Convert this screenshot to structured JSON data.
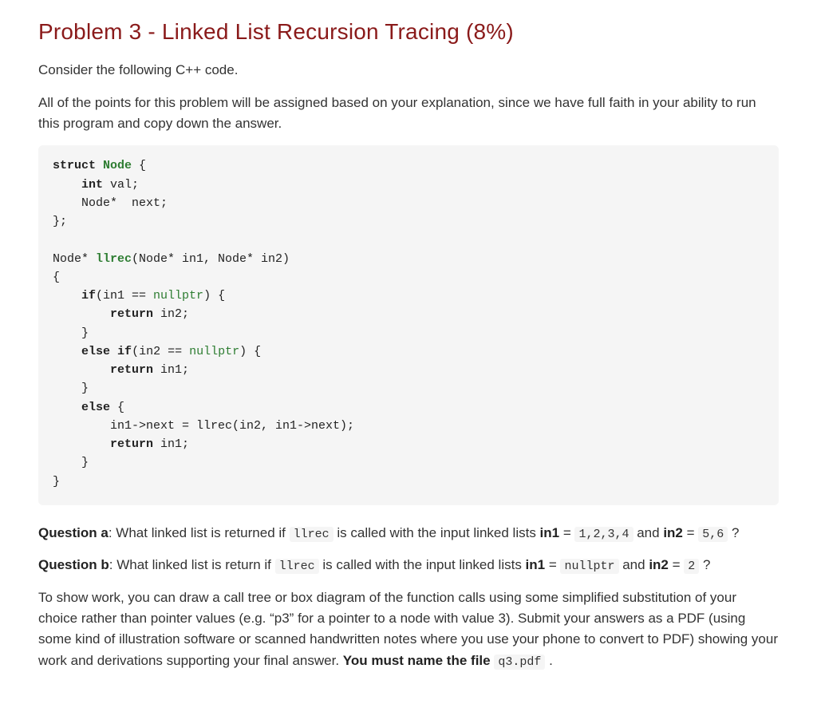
{
  "title": "Problem 3 - Linked List Recursion Tracing (8%)",
  "intro1": "Consider the following C++ code.",
  "intro2": "All of the points for this problem will be assigned based on your explanation, since we have full faith in your ability to run this program and copy down the answer.",
  "code": {
    "l01a": "struct",
    "l01b": "Node",
    "l01c": " {",
    "l02a": "    ",
    "l02b": "int",
    "l02c": " val;",
    "l03": "    Node*  next;",
    "l04": "};",
    "l05": "",
    "l06a": "Node* ",
    "l06b": "llrec",
    "l06c": "(Node* in1, Node* in2)",
    "l07": "{",
    "l08a": "    ",
    "l08b": "if",
    "l08c": "(in1 == ",
    "l08d": "nullptr",
    "l08e": ") {",
    "l09a": "        ",
    "l09b": "return",
    "l09c": " in2;",
    "l10": "    }",
    "l11a": "    ",
    "l11b": "else",
    "l11c": " ",
    "l11d": "if",
    "l11e": "(in2 == ",
    "l11f": "nullptr",
    "l11g": ") {",
    "l12a": "        ",
    "l12b": "return",
    "l12c": " in1;",
    "l13": "    }",
    "l14a": "    ",
    "l14b": "else",
    "l14c": " {",
    "l15": "        in1->next = llrec(in2, in1->next);",
    "l16a": "        ",
    "l16b": "return",
    "l16c": " in1;",
    "l17": "    }",
    "l18": "}"
  },
  "qa": {
    "label": "Question a",
    "before": ": What linked list is returned if ",
    "code1": "llrec",
    "mid1": " is called with the input linked lists ",
    "in1_label": "in1",
    "eq": " = ",
    "code2": "1,2,3,4",
    "mid2": " and ",
    "in2_label": "in2",
    "code3": "5,6",
    "after": " ?"
  },
  "qb": {
    "label": "Question b",
    "before": ": What linked list is return if ",
    "code1": "llrec",
    "mid1": " is called with the input linked lists ",
    "in1_label": "in1",
    "eq": " = ",
    "code2": "nullptr",
    "mid2": " and ",
    "in2_label": "in2",
    "code3": "2",
    "after": " ?"
  },
  "closing": {
    "t1": "To show work, you can draw a call tree or box diagram of the function calls using some simplified substitution of your choice rather than pointer values (e.g. “p3” for a pointer to a node with value 3). Submit your answers as a PDF (using some kind of illustration software or scanned handwritten notes where you use your phone to convert to PDF) showing your work and derivations supporting your final answer. ",
    "bold": "You must name the file ",
    "code": "q3.pdf",
    "tail": " ."
  }
}
